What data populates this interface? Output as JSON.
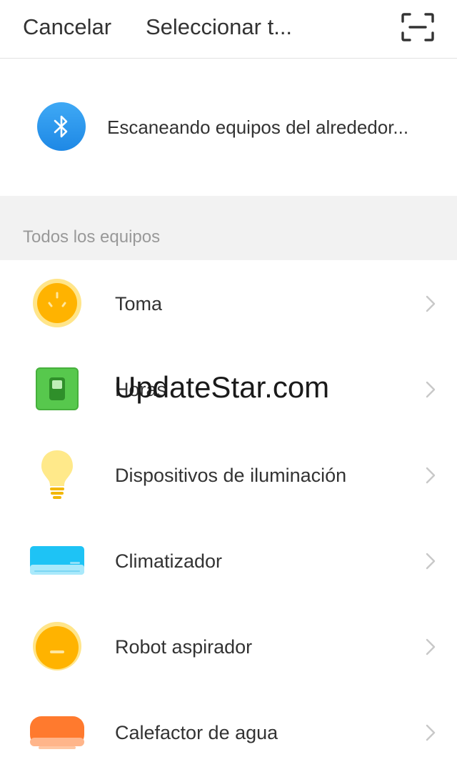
{
  "header": {
    "cancel_label": "Cancelar",
    "title": "Seleccionar t...",
    "scan_icon": "scan-frame-icon"
  },
  "scanning": {
    "icon": "bluetooth-icon",
    "text": "Escaneando equipos del alrededor...",
    "accent": "#2196f3"
  },
  "section": {
    "title": "Todos los equipos"
  },
  "devices": [
    {
      "label": "Toma",
      "icon": "socket-icon"
    },
    {
      "label": "Horas",
      "icon": "switch-icon"
    },
    {
      "label": "Dispositivos de iluminación",
      "icon": "light-bulb-icon"
    },
    {
      "label": "Climatizador",
      "icon": "air-conditioner-icon"
    },
    {
      "label": "Robot aspirador",
      "icon": "robot-vacuum-icon"
    },
    {
      "label": "Calefactor de agua",
      "icon": "water-heater-icon"
    }
  ],
  "watermark": "UpdateStar.com"
}
